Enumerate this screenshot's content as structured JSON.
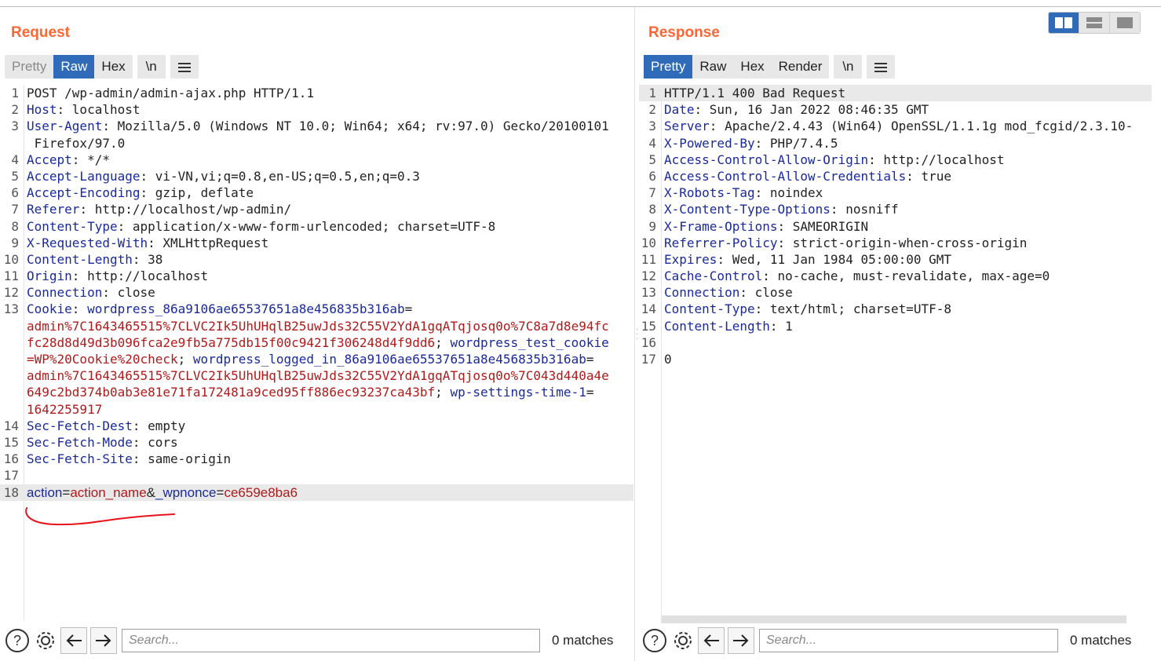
{
  "layout_icons": [
    "split-horizontal-icon",
    "split-vertical-icon",
    "single-pane-icon"
  ],
  "request": {
    "title": "Request",
    "tabs": [
      "Pretty",
      "Raw",
      "Hex"
    ],
    "active_tab": "Raw",
    "newline_button": "\\n",
    "lines": [
      {
        "n": "1",
        "text": "POST /wp-admin/admin-ajax.php HTTP/1.1"
      },
      {
        "n": "2",
        "key": "Host",
        "val": "localhost"
      },
      {
        "n": "3",
        "key": "User-Agent",
        "val": "Mozilla/5.0 (Windows NT 10.0; Win64; x64; rv:97.0) Gecko/20100101"
      },
      {
        "n": "",
        "text": " Firefox/97.0"
      },
      {
        "n": "4",
        "key": "Accept",
        "val": "*/*"
      },
      {
        "n": "5",
        "key": "Accept-Language",
        "val": "vi-VN,vi;q=0.8,en-US;q=0.5,en;q=0.3"
      },
      {
        "n": "6",
        "key": "Accept-Encoding",
        "val": "gzip, deflate"
      },
      {
        "n": "7",
        "key": "Referer",
        "val": "http://localhost/wp-admin/"
      },
      {
        "n": "8",
        "key": "Content-Type",
        "val": "application/x-www-form-urlencoded; charset=UTF-8"
      },
      {
        "n": "9",
        "key": "X-Requested-With",
        "val": "XMLHttpRequest"
      },
      {
        "n": "10",
        "key": "Content-Length",
        "val": "38"
      },
      {
        "n": "11",
        "key": "Origin",
        "val": "http://localhost"
      },
      {
        "n": "12",
        "key": "Connection",
        "val": "close"
      }
    ],
    "cookie": {
      "n": "13",
      "key": "Cookie",
      "c1_name": "wordpress_86a9106ae65537651a8e456835b316ab",
      "c1_val_a": "admin%7C1643465515%7CLVC2Ik5UhUHqlB25uwJds32C55V2YdA1gqATqjosq0o%7C8a7d8e94fc",
      "c1_val_b": "fc28d8d49d3b096fca2e9fb5a775db15f00c9421f306248d4f9dd6",
      "c2_name_a": "wordpress_test_cookie",
      "c2_val": "=WP%20Cookie%20check",
      "c3_name": "wordpress_logged_in_86a9106ae65537651a8e456835b316ab",
      "c3_val_a": "admin%7C1643465515%7CLVC2Ik5UhUHqlB25uwJds32C55V2YdA1gqATqjosq0o%7C043d440a4e",
      "c3_val_b": "649c2bd374b0ab3e81e71fa172481a9ced95ff886ec93237ca43bf",
      "c4_name": "wp-settings-time-1",
      "c4_val": "1642255917"
    },
    "lines_after": [
      {
        "n": "14",
        "key": "Sec-Fetch-Dest",
        "val": "empty"
      },
      {
        "n": "15",
        "key": "Sec-Fetch-Mode",
        "val": "cors"
      },
      {
        "n": "16",
        "key": "Sec-Fetch-Site",
        "val": "same-origin"
      },
      {
        "n": "17",
        "text": ""
      }
    ],
    "body_line": {
      "n": "18",
      "p1_name": "action",
      "p1_val": "action_name",
      "p2_name": "_wpnonce",
      "p2_val": "ce659e8ba6"
    },
    "search_placeholder": "Search...",
    "matches": "0 matches"
  },
  "response": {
    "title": "Response",
    "tabs": [
      "Pretty",
      "Raw",
      "Hex",
      "Render"
    ],
    "active_tab": "Pretty",
    "newline_button": "\\n",
    "lines": [
      {
        "n": "1",
        "text": "HTTP/1.1 400 Bad Request"
      },
      {
        "n": "2",
        "key": "Date",
        "val": "Sun, 16 Jan 2022 08:46:35 GMT"
      },
      {
        "n": "3",
        "key": "Server",
        "val": "Apache/2.4.43 (Win64) OpenSSL/1.1.1g mod_fcgid/2.3.10-"
      },
      {
        "n": "4",
        "key": "X-Powered-By",
        "val": "PHP/7.4.5"
      },
      {
        "n": "5",
        "key": "Access-Control-Allow-Origin",
        "val": "http://localhost"
      },
      {
        "n": "6",
        "key": "Access-Control-Allow-Credentials",
        "val": "true"
      },
      {
        "n": "7",
        "key": "X-Robots-Tag",
        "val": "noindex"
      },
      {
        "n": "8",
        "key": "X-Content-Type-Options",
        "val": "nosniff"
      },
      {
        "n": "9",
        "key": "X-Frame-Options",
        "val": "SAMEORIGIN"
      },
      {
        "n": "10",
        "key": "Referrer-Policy",
        "val": "strict-origin-when-cross-origin"
      },
      {
        "n": "11",
        "key": "Expires",
        "val": "Wed, 11 Jan 1984 05:00:00 GMT"
      },
      {
        "n": "12",
        "key": "Cache-Control",
        "val": "no-cache, must-revalidate, max-age=0"
      },
      {
        "n": "13",
        "key": "Connection",
        "val": "close"
      },
      {
        "n": "14",
        "key": "Content-Type",
        "val": "text/html; charset=UTF-8"
      },
      {
        "n": "15",
        "key": "Content-Length",
        "val": "1"
      },
      {
        "n": "16",
        "text": ""
      },
      {
        "n": "17",
        "text": "0"
      }
    ],
    "search_placeholder": "Search...",
    "matches": "0 matches"
  },
  "colors": {
    "accent_title": "#ff6633",
    "active_tab": "#2f6bb8",
    "header_key": "#1a2a9a",
    "cookie_value": "#b01a1a",
    "annotation_underline": "#e8141a"
  }
}
